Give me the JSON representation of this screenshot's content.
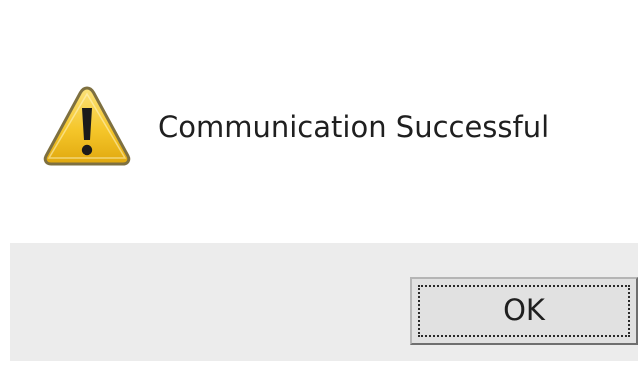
{
  "dialog": {
    "icon": "warning-icon",
    "message": "Communication Successful",
    "ok_label": "OK"
  },
  "colors": {
    "icon_yellow": "#f3c21f",
    "icon_outline": "#8a7a4a",
    "button_bar": "#ececec",
    "button_face": "#e1e1e1"
  }
}
